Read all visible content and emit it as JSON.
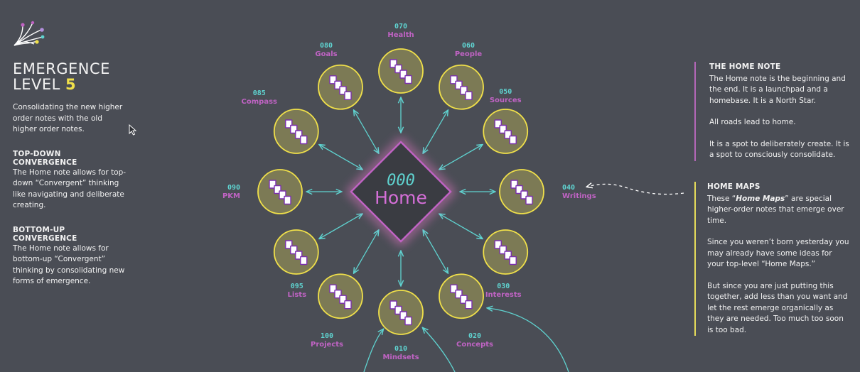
{
  "left": {
    "title_line1": "EMERGENCE",
    "title_line2": "LEVEL",
    "level": "5",
    "intro": "Consolidating the new higher order notes with the old higher order notes.",
    "section1_heading": "TOP-DOWN CONVERGENCE",
    "section1_body": "The Home note allows for top-down “Convergent” thinking like navigating and deliberate creating.",
    "section2_heading": "BOTTOM-UP CONVERGENCE",
    "section2_body": "The Home note allows for bottom-up “Convergent” thinking by consolidating new forms of emergence."
  },
  "center": {
    "code": "000",
    "label": "Home"
  },
  "nodes": [
    {
      "code": "070",
      "label": "Health"
    },
    {
      "code": "060",
      "label": "People"
    },
    {
      "code": "050",
      "label": "Sources"
    },
    {
      "code": "040",
      "label": "Writings"
    },
    {
      "code": "030",
      "label": "Interests"
    },
    {
      "code": "020",
      "label": "Concepts"
    },
    {
      "code": "010",
      "label": "Mindsets"
    },
    {
      "code": "100",
      "label": "Projects"
    },
    {
      "code": "095",
      "label": "Lists"
    },
    {
      "code": "090",
      "label": "PKM"
    },
    {
      "code": "085",
      "label": "Compass"
    },
    {
      "code": "080",
      "label": "Goals"
    }
  ],
  "right": {
    "home_note_heading": "THE HOME NOTE",
    "home_note_p1": "The Home note is the beginning and the end. It is a launchpad and a homebase. It is a North Star.",
    "home_note_p2": "All roads lead to home.",
    "home_note_p3": "It is a spot to deliberately create. It is a spot to consciously consolidate.",
    "home_maps_heading": "HOME MAPS",
    "home_maps_p1_pre": "These “",
    "home_maps_p1_em": "Home Maps",
    "home_maps_p1_post": "” are special higher-order notes that emerge over time.",
    "home_maps_p2": "Since you weren’t born yesterday you may already have some ideas for your top-level “Home Maps.”",
    "home_maps_p3": "But since you are just putting this together, add less than you want and let the rest emerge organically as they are needed. Too much too soon is too bad."
  },
  "colors": {
    "background": "#4a4d55",
    "teal": "#5fd3d0",
    "magenta": "#c063c4",
    "yellow": "#f0e04a",
    "node_fill": "#7c7a55",
    "diamond_fill": "#3a3c42"
  },
  "icons": {
    "logo": "emergence-sparkle-icon",
    "node": "note-stack-icon",
    "cursor": "mouse-cursor-icon"
  }
}
